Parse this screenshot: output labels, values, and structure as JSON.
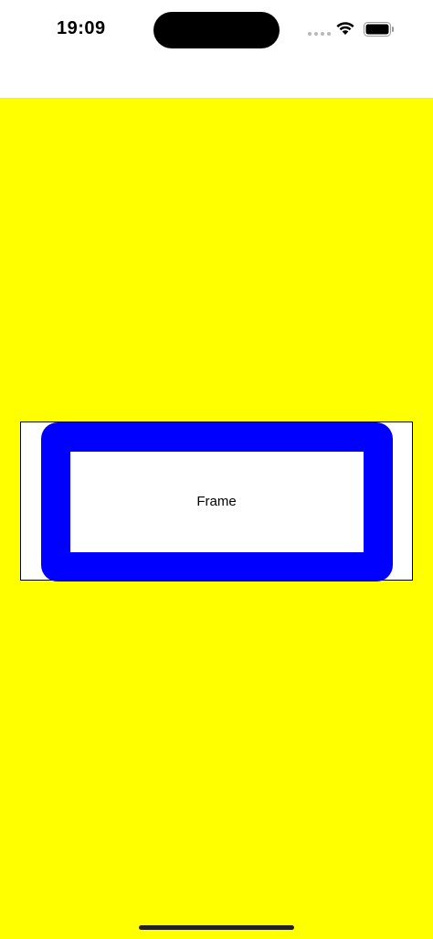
{
  "status_bar": {
    "time": "19:09",
    "icons": [
      "signal-dots-icon",
      "wifi-icon",
      "battery-icon"
    ]
  },
  "content": {
    "frame_label": "Frame"
  },
  "colors": {
    "background": "#ffff00",
    "frame_border": "#0000ff",
    "frame_fill": "#ffffff",
    "outline": "#000000"
  }
}
